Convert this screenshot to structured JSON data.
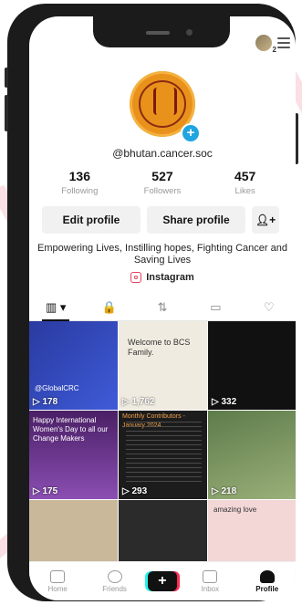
{
  "profile": {
    "handle": "@bhutan.cancer.soc",
    "stats": [
      {
        "value": "136",
        "label": "Following"
      },
      {
        "value": "527",
        "label": "Followers"
      },
      {
        "value": "457",
        "label": "Likes"
      }
    ],
    "actions": {
      "edit": "Edit profile",
      "share": "Share profile"
    },
    "bio": "Empowering Lives, Instilling hopes, Fighting Cancer and Saving Lives",
    "link": "Instagram"
  },
  "top": {
    "badge": "2"
  },
  "tabs": [
    "▥ ▾",
    "🔒",
    "⇅",
    "▭",
    "♡"
  ],
  "grid": [
    {
      "views": "178",
      "caption": "@GlobalCRC"
    },
    {
      "views": "1,762",
      "caption": "Welcome to BCS Family."
    },
    {
      "views": "332",
      "caption": ""
    },
    {
      "views": "175",
      "caption": "Happy International Women's Day to all our Change Makers"
    },
    {
      "views": "293",
      "caption": "Monthly Contributors - January 2024"
    },
    {
      "views": "218",
      "caption": ""
    },
    {
      "views": "",
      "caption": ""
    },
    {
      "views": "",
      "caption": ""
    },
    {
      "views": "",
      "caption": "amazing love"
    }
  ],
  "nav": {
    "home": "Home",
    "friends": "Friends",
    "create": "+",
    "inbox": "Inbox",
    "profile": "Profile"
  }
}
